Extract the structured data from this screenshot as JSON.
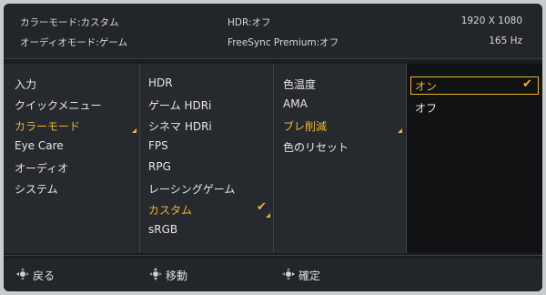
{
  "header": {
    "color_mode": "カラーモード:カスタム",
    "audio_mode": "オーディオモード:ゲーム",
    "hdr": "HDR:オフ",
    "freesync": "FreeSync Premium:オフ",
    "resolution": "1920 X 1080",
    "refresh": "165 Hz"
  },
  "menu": {
    "main": [
      "入力",
      "クイックメニュー",
      "カラーモード",
      "Eye Care",
      "オーディオ",
      "システム"
    ],
    "modes": [
      "HDR",
      "ゲーム HDRi",
      "シネマ HDRi",
      "FPS",
      "RPG",
      "レーシングゲーム",
      "カスタム",
      "sRGB"
    ],
    "settings": [
      "色温度",
      "AMA",
      "ブレ削減",
      "色のリセット"
    ],
    "options": [
      "オン",
      "オフ"
    ]
  },
  "footer": {
    "back": "戻る",
    "move": "移動",
    "confirm": "確定"
  },
  "colors": {
    "accent": "#f0b429",
    "panel": "#26292e",
    "background": "#1b1d21"
  }
}
